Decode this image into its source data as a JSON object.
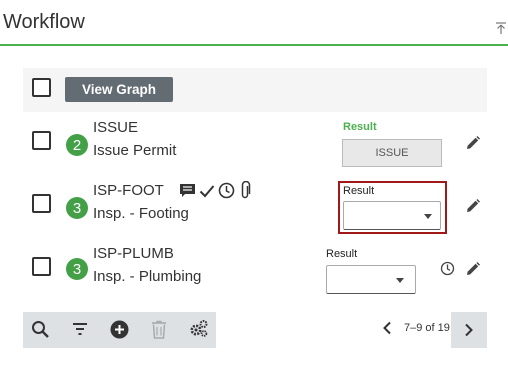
{
  "header": {
    "title": "Workflow"
  },
  "toolbar_top": {
    "view_graph_label": "View Graph"
  },
  "rows": [
    {
      "badge": "2",
      "code": "ISSUE",
      "desc": "Issue Permit",
      "result_label": "Result",
      "result_value": "ISSUE"
    },
    {
      "badge": "3",
      "code": "ISP-FOOT",
      "desc": "Insp. - Footing",
      "result_label": "Result",
      "result_value": ""
    },
    {
      "badge": "3",
      "code": "ISP-PLUMB",
      "desc": "Insp. - Plumbing",
      "result_label": "Result",
      "result_value": ""
    }
  ],
  "pagination": {
    "range_text": "7–9 of 19"
  },
  "colors": {
    "accent_green": "#4caf50",
    "badge_green": "#43a047",
    "highlight_red": "#a01818",
    "button_gray": "#636b73"
  },
  "icons": [
    "collapse-icon",
    "edit-icon",
    "comment-icon",
    "check-icon",
    "clock-icon",
    "paperclip-icon",
    "search-icon",
    "filter-icon",
    "add-icon",
    "delete-icon",
    "settings-icon",
    "chevron-left-icon",
    "chevron-right-icon",
    "caret-down-icon"
  ]
}
